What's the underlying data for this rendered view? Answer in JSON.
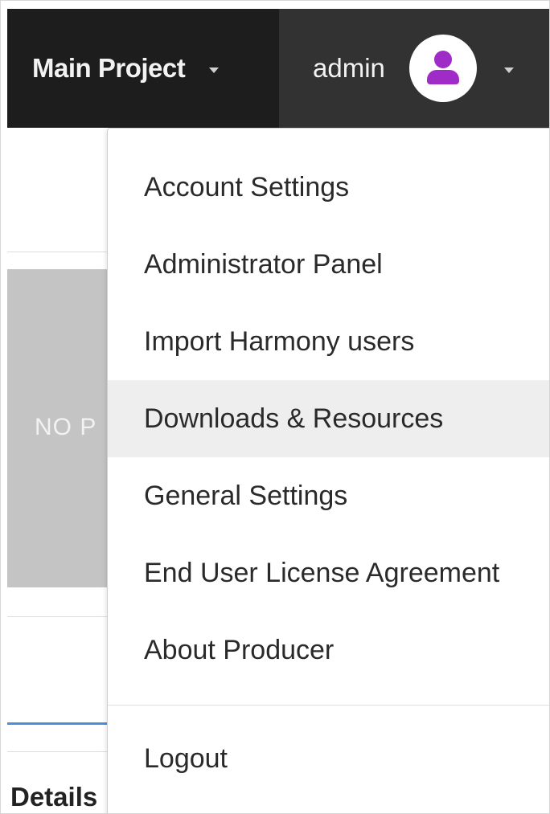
{
  "header": {
    "project_name": "Main Project",
    "username": "admin",
    "accent_color": "#a02cc7"
  },
  "background": {
    "thumbnail_text": "NO P",
    "details_label": "Details"
  },
  "user_dropdown": {
    "items": [
      {
        "label": "Account Settings"
      },
      {
        "label": "Administrator Panel"
      },
      {
        "label": "Import Harmony users"
      },
      {
        "label": "Downloads & Resources",
        "highlighted": true
      },
      {
        "label": "General Settings"
      },
      {
        "label": "End User License Agreement"
      },
      {
        "label": "About Producer"
      }
    ],
    "logout_label": "Logout"
  }
}
